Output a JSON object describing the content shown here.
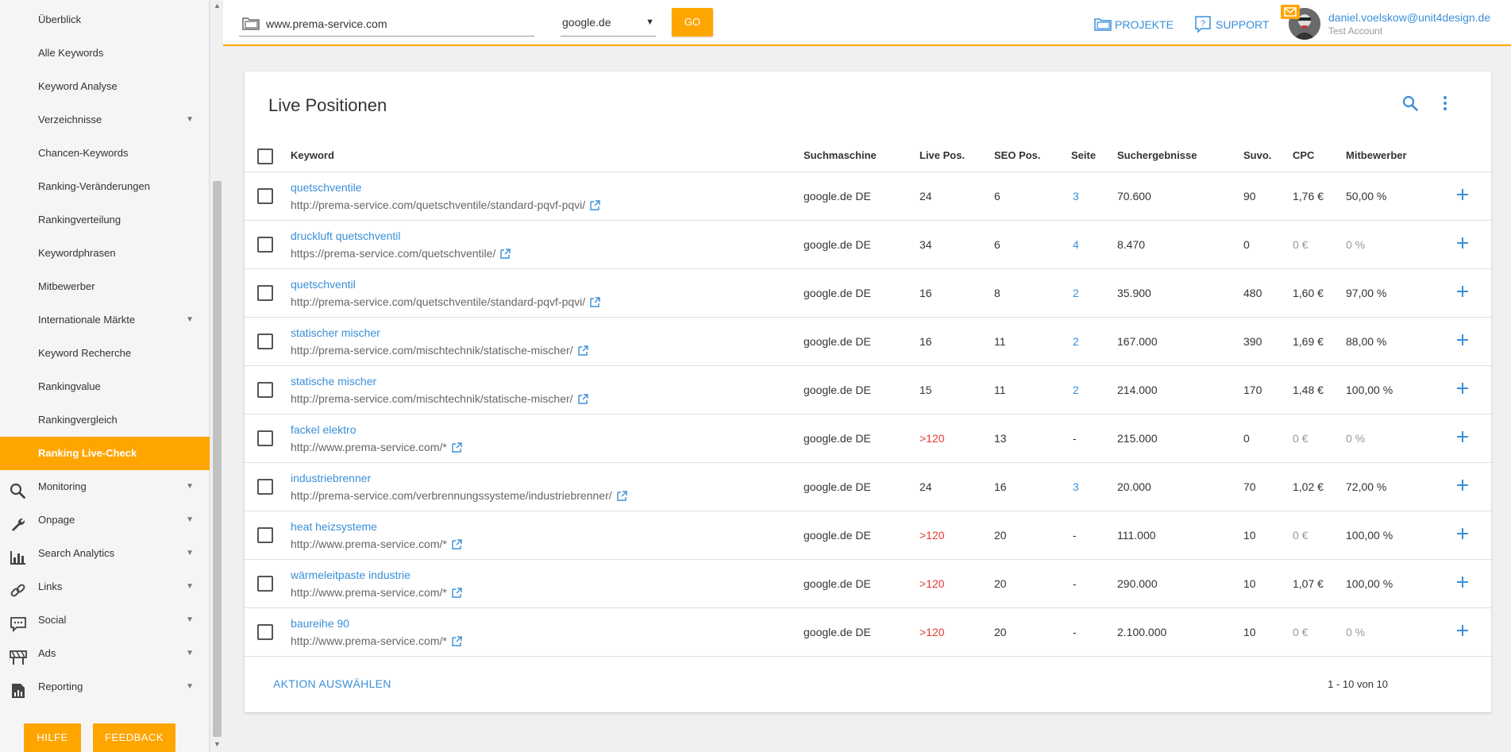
{
  "sidebar": {
    "sub_items": [
      {
        "label": "Überblick",
        "caret": false
      },
      {
        "label": "Alle Keywords",
        "caret": false
      },
      {
        "label": "Keyword Analyse",
        "caret": false
      },
      {
        "label": "Verzeichnisse",
        "caret": true
      },
      {
        "label": "Chancen-Keywords",
        "caret": false
      },
      {
        "label": "Ranking-Veränderungen",
        "caret": false
      },
      {
        "label": "Rankingverteilung",
        "caret": false
      },
      {
        "label": "Keywordphrasen",
        "caret": false
      },
      {
        "label": "Mitbewerber",
        "caret": false
      },
      {
        "label": "Internationale Märkte",
        "caret": true
      },
      {
        "label": "Keyword Recherche",
        "caret": false
      },
      {
        "label": "Rankingvalue",
        "caret": false
      },
      {
        "label": "Rankingvergleich",
        "caret": false
      },
      {
        "label": "Ranking Live-Check",
        "caret": false,
        "active": true
      }
    ],
    "main_items": [
      {
        "label": "Monitoring",
        "icon": "search-icon"
      },
      {
        "label": "Onpage",
        "icon": "wrench-icon"
      },
      {
        "label": "Search Analytics",
        "icon": "bar-chart-icon"
      },
      {
        "label": "Links",
        "icon": "link-icon"
      },
      {
        "label": "Social",
        "icon": "speech-bubble-icon"
      },
      {
        "label": "Ads",
        "icon": "billboard-icon"
      },
      {
        "label": "Reporting",
        "icon": "report-icon"
      }
    ],
    "help_label": "HILFE",
    "feedback_label": "FEEDBACK"
  },
  "topbar": {
    "url_value": "www.prema-service.com",
    "engine_value": "google.de",
    "go_label": "GO",
    "projects_label": "PROJEKTE",
    "support_label": "SUPPORT",
    "user_email": "daniel.voelskow@unit4design.de",
    "user_account": "Test Account"
  },
  "colors": {
    "accent": "#ffa500",
    "link": "#3a8fd8",
    "alert": "#e53935"
  },
  "card": {
    "title": "Live Positionen",
    "action_label": "AKTION AUSWÄHLEN",
    "pagination": "1 - 10 von 10"
  },
  "table": {
    "columns": [
      "Keyword",
      "Suchmaschine",
      "Live Pos.",
      "SEO Pos.",
      "Seite",
      "Suchergebnisse",
      "Suvo.",
      "CPC",
      "Mitbewerber"
    ],
    "rows": [
      {
        "keyword": "quetschventile",
        "url": "http://prema-service.com/quetschventile/standard-pqvf-pqvi/",
        "engine": "google.de DE",
        "live": "24",
        "seo": "6",
        "page": "3",
        "results": "70.600",
        "suvo": "90",
        "cpc": "1,76 €",
        "competitors": "50,00 %"
      },
      {
        "keyword": "druckluft quetschventil",
        "url": "https://prema-service.com/quetschventile/",
        "engine": "google.de DE",
        "live": "34",
        "seo": "6",
        "page": "4",
        "results": "8.470",
        "suvo": "0",
        "cpc": "0 €",
        "competitors": "0 %"
      },
      {
        "keyword": "quetschventil",
        "url": "http://prema-service.com/quetschventile/standard-pqvf-pqvi/",
        "engine": "google.de DE",
        "live": "16",
        "seo": "8",
        "page": "2",
        "results": "35.900",
        "suvo": "480",
        "cpc": "1,60 €",
        "competitors": "97,00 %"
      },
      {
        "keyword": "statischer mischer",
        "url": "http://prema-service.com/mischtechnik/statische-mischer/",
        "engine": "google.de DE",
        "live": "16",
        "seo": "11",
        "page": "2",
        "results": "167.000",
        "suvo": "390",
        "cpc": "1,69 €",
        "competitors": "88,00 %"
      },
      {
        "keyword": "statische mischer",
        "url": "http://prema-service.com/mischtechnik/statische-mischer/",
        "engine": "google.de DE",
        "live": "15",
        "seo": "11",
        "page": "2",
        "results": "214.000",
        "suvo": "170",
        "cpc": "1,48 €",
        "competitors": "100,00 %"
      },
      {
        "keyword": "fackel elektro",
        "url": "http://www.prema-service.com/*",
        "engine": "google.de DE",
        "live": ">120",
        "seo": "13",
        "page": "-",
        "results": "215.000",
        "suvo": "0",
        "cpc": "0 €",
        "competitors": "0 %"
      },
      {
        "keyword": "industriebrenner",
        "url": "http://prema-service.com/verbrennungssysteme/industriebrenner/",
        "engine": "google.de DE",
        "live": "24",
        "seo": "16",
        "page": "3",
        "results": "20.000",
        "suvo": "70",
        "cpc": "1,02 €",
        "competitors": "72,00 %"
      },
      {
        "keyword": "heat heizsysteme",
        "url": "http://www.prema-service.com/*",
        "engine": "google.de DE",
        "live": ">120",
        "seo": "20",
        "page": "-",
        "results": "111.000",
        "suvo": "10",
        "cpc": "0 €",
        "competitors": "100,00 %"
      },
      {
        "keyword": "wärmeleitpaste industrie",
        "url": "http://www.prema-service.com/*",
        "engine": "google.de DE",
        "live": ">120",
        "seo": "20",
        "page": "-",
        "results": "290.000",
        "suvo": "10",
        "cpc": "1,07 €",
        "competitors": "100,00 %"
      },
      {
        "keyword": "baureihe 90",
        "url": "http://www.prema-service.com/*",
        "engine": "google.de DE",
        "live": ">120",
        "seo": "20",
        "page": "-",
        "results": "2.100.000",
        "suvo": "10",
        "cpc": "0 €",
        "competitors": "0 %"
      }
    ]
  }
}
